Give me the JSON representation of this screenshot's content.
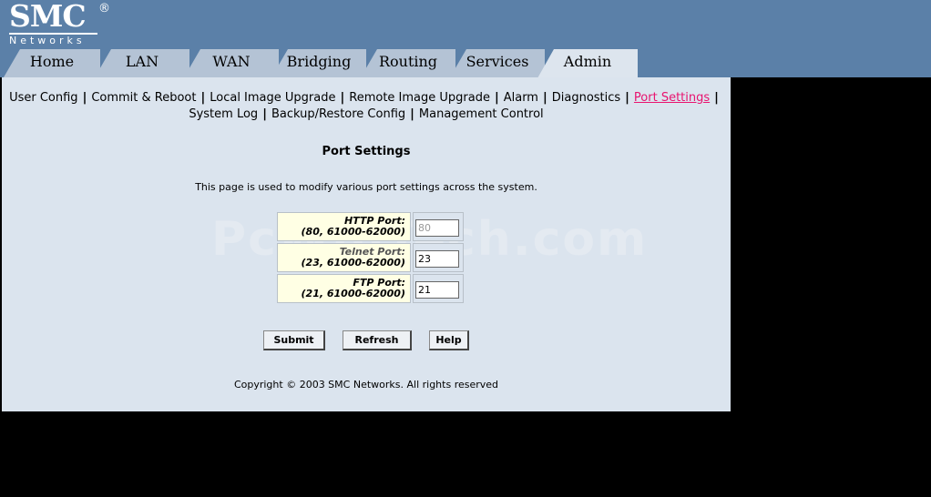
{
  "logo": {
    "brand": "SMC",
    "reg": "®",
    "sub": "Networks"
  },
  "tabs": [
    {
      "label": "Home"
    },
    {
      "label": "LAN"
    },
    {
      "label": "WAN"
    },
    {
      "label": "Bridging"
    },
    {
      "label": "Routing"
    },
    {
      "label": "Services"
    },
    {
      "label": "Admin",
      "active": true
    }
  ],
  "submenu": {
    "row1": [
      "User Config",
      "Commit & Reboot",
      "Local Image Upgrade",
      "Remote Image Upgrade",
      "Alarm",
      "Diagnostics",
      "Port Settings"
    ],
    "row2": [
      "System Log",
      "Backup/Restore Config",
      "Management Control"
    ],
    "active": "Port Settings",
    "separator": "|"
  },
  "page": {
    "title": "Port Settings",
    "description": "This page is used to modify various port settings across the system.",
    "watermark": "PcWinTech.com"
  },
  "ports": [
    {
      "label": "HTTP Port:",
      "range": "(80, 61000-62000)",
      "value": "80",
      "disabled": true
    },
    {
      "label": "Telnet Port:",
      "range": "(23, 61000-62000)",
      "value": "23",
      "disabled": false
    },
    {
      "label": "FTP Port:",
      "range": "(21, 61000-62000)",
      "value": "21",
      "disabled": false
    }
  ],
  "buttons": {
    "submit": "Submit",
    "refresh": "Refresh",
    "help": "Help"
  },
  "footer": {
    "copyright": "Copyright © 2003 SMC Networks. All rights reserved"
  },
  "colors": {
    "header": "#5b80a8",
    "tab": "#b4c3d5",
    "tab_active": "#dde5ee",
    "panel": "#dbe4ee",
    "active_link": "#e8136f",
    "label_bg": "#ffffe4"
  }
}
